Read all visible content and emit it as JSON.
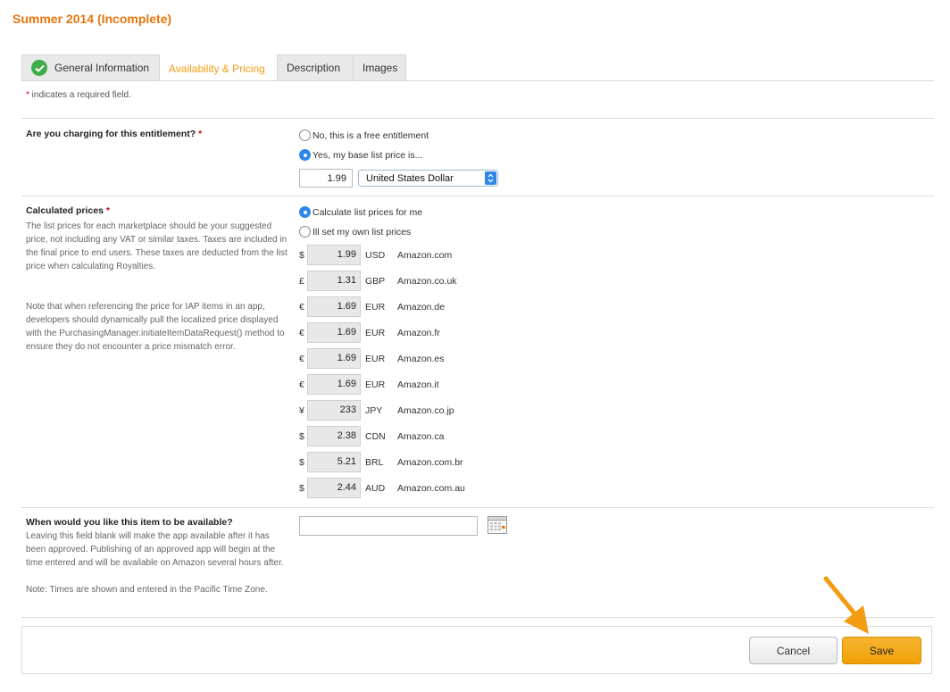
{
  "page": {
    "title": "Summer 2014 (Incomplete)"
  },
  "tabs": [
    {
      "label": "General Information",
      "completed": true
    },
    {
      "label": "Availability & Pricing",
      "active": true
    },
    {
      "label": "Description"
    },
    {
      "label": "Images"
    }
  ],
  "required_note": {
    "star": "*",
    "text": " indicates a required field."
  },
  "charging": {
    "label": "Are you charging for this entitlement?",
    "star": "*",
    "option_free": "No, this is a free entitlement",
    "option_paid": "Yes, my base list price is...",
    "selected": "paid",
    "base_price": "1.99",
    "currency": "United States Dollar"
  },
  "calculated": {
    "label": "Calculated prices",
    "star": "*",
    "desc1": "The list prices for each marketplace should be your suggested price, not including any VAT or similar taxes. Taxes are included in the final price to end users. These taxes are deducted from the list price when calculating Royalties.",
    "desc2": "Note that when referencing the price for IAP items in an app, developers should dynamically pull the localized price displayed with the PurchasingManager.initiateItemDataRequest() method to ensure they do not encounter a price mismatch error.",
    "option_calc": "Calculate list prices for me",
    "option_own": "Ill set my own list prices",
    "selected": "calc",
    "prices": [
      {
        "symbol": "$",
        "value": "1.99",
        "currency": "USD",
        "marketplace": "Amazon.com"
      },
      {
        "symbol": "£",
        "value": "1.31",
        "currency": "GBP",
        "marketplace": "Amazon.co.uk"
      },
      {
        "symbol": "€",
        "value": "1.69",
        "currency": "EUR",
        "marketplace": "Amazon.de"
      },
      {
        "symbol": "€",
        "value": "1.69",
        "currency": "EUR",
        "marketplace": "Amazon.fr"
      },
      {
        "symbol": "€",
        "value": "1.69",
        "currency": "EUR",
        "marketplace": "Amazon.es"
      },
      {
        "symbol": "€",
        "value": "1.69",
        "currency": "EUR",
        "marketplace": "Amazon.it"
      },
      {
        "symbol": "¥",
        "value": "233",
        "currency": "JPY",
        "marketplace": "Amazon.co.jp"
      },
      {
        "symbol": "$",
        "value": "2.38",
        "currency": "CDN",
        "marketplace": "Amazon.ca"
      },
      {
        "symbol": "$",
        "value": "5.21",
        "currency": "BRL",
        "marketplace": "Amazon.com.br"
      },
      {
        "symbol": "$",
        "value": "2.44",
        "currency": "AUD",
        "marketplace": "Amazon.com.au"
      }
    ]
  },
  "availability": {
    "label": "When would you like this item to be available?",
    "desc": "Leaving this field blank will make the app available after it has been approved. Publishing of an approved app will begin at the time entered and will be available on Amazon several hours after.",
    "note": "Note: Times are shown and entered in the Pacific Time Zone.",
    "date_value": "",
    "calendar_icon": "calendar-icon"
  },
  "footer": {
    "cancel_label": "Cancel",
    "save_label": "Save"
  },
  "colors": {
    "accent": "#e8750c",
    "save_button": "#f0a106",
    "radio_selected": "#2f86ea",
    "check": "#3fae49"
  }
}
